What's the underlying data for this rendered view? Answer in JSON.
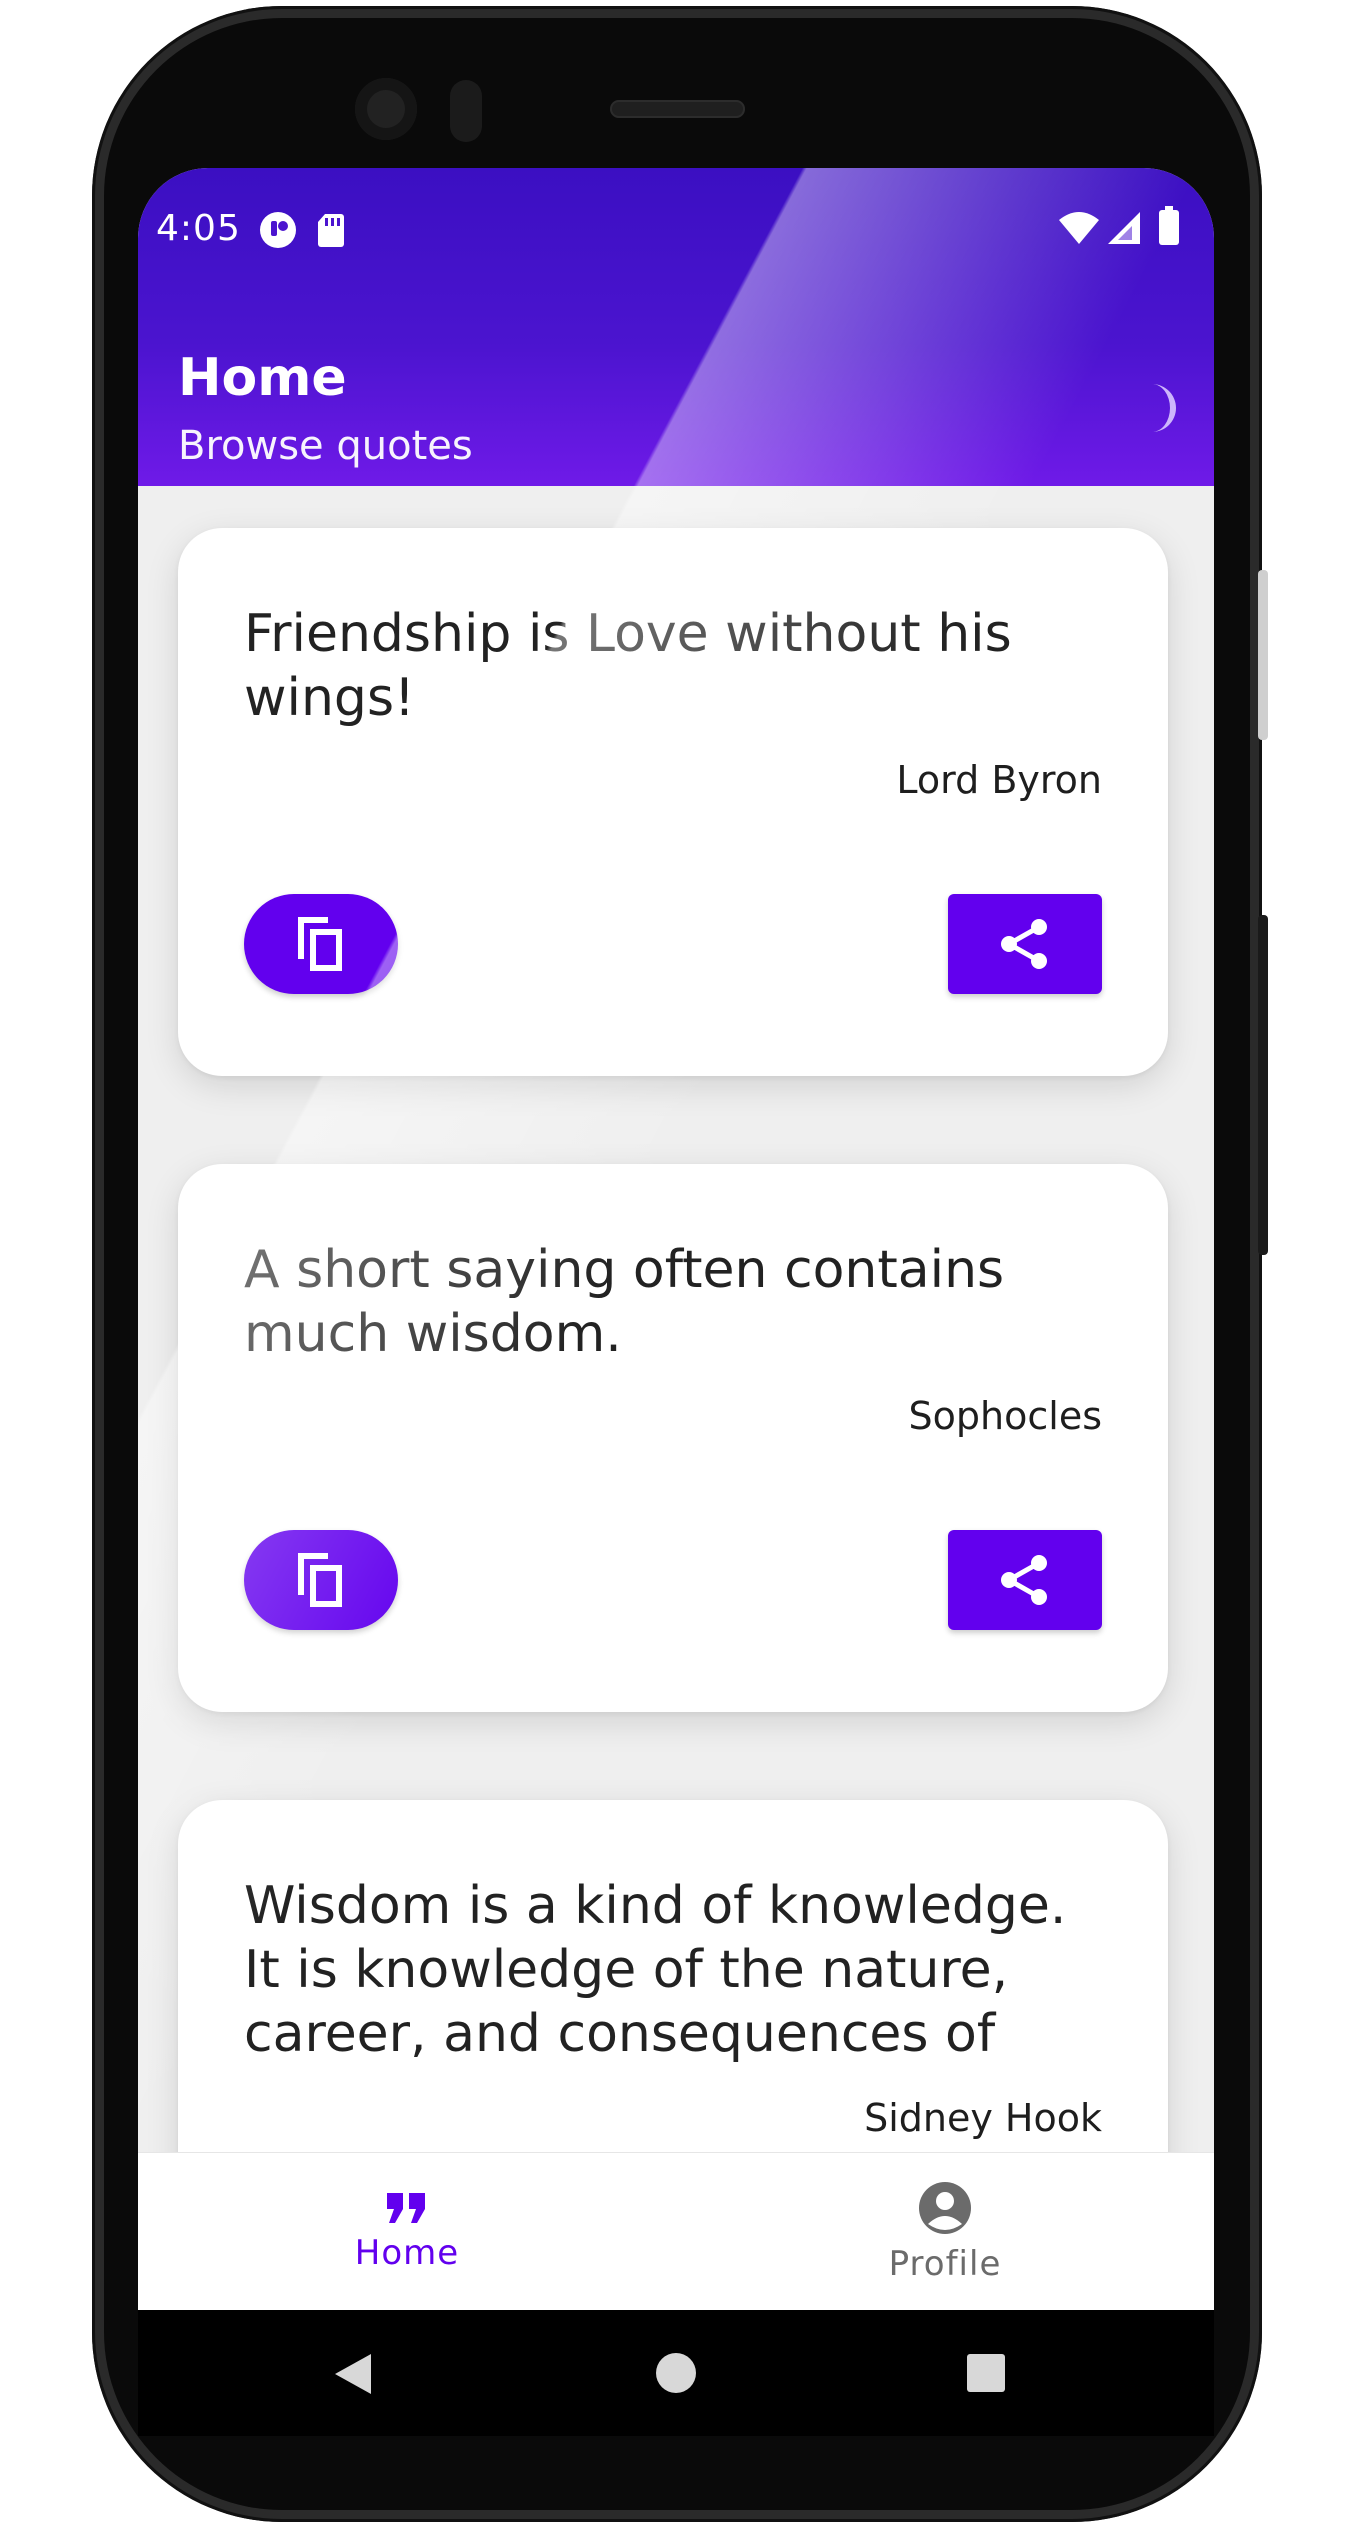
{
  "status_bar": {
    "time": "4:05"
  },
  "header": {
    "title": "Home",
    "subtitle": "Browse quotes"
  },
  "quotes": [
    {
      "text": "Friendship is Love without his wings!",
      "author": "Lord Byron"
    },
    {
      "text": "A short saying often contains much wisdom.",
      "author": "Sophocles"
    },
    {
      "text": "Wisdom is a kind of knowledge. It is knowledge of the nature, career, and consequences of hu…",
      "author": "Sidney Hook"
    }
  ],
  "bottom_nav": {
    "items": [
      {
        "label": "Home",
        "icon": "quote-icon",
        "active": true
      },
      {
        "label": "Profile",
        "icon": "account-circle-icon",
        "active": false
      }
    ]
  },
  "colors": {
    "accent": "#6200ee",
    "header_gradient_start": "#3b0fc2",
    "header_gradient_end": "#6f1ae8",
    "inactive": "#6b6b6b"
  },
  "system_nav": {
    "icons": [
      "back-icon",
      "home-icon",
      "recents-icon"
    ]
  }
}
